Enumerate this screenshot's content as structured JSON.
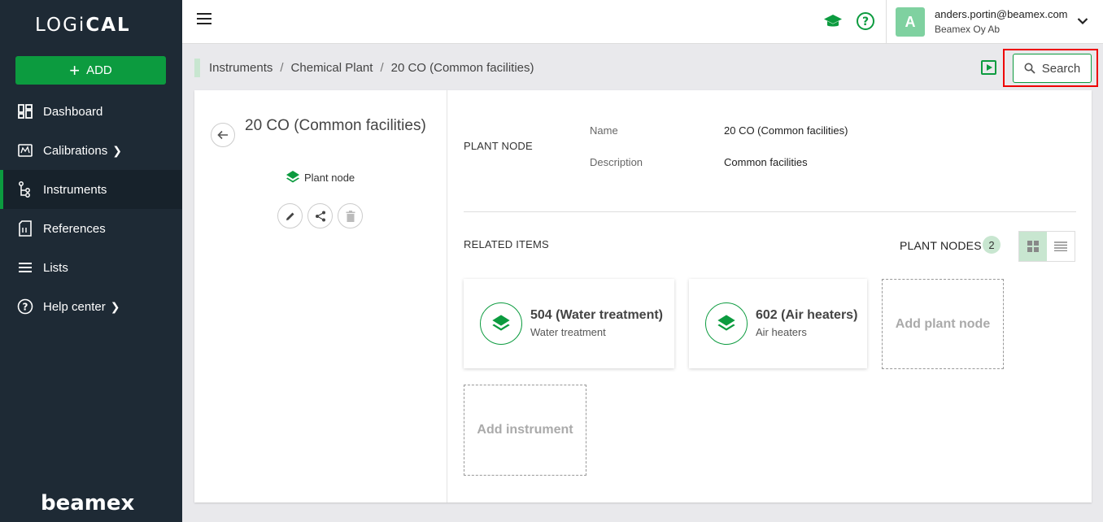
{
  "sidebar": {
    "logo_prefix": "LOGi",
    "logo_suffix": "CAL",
    "add_label": "ADD",
    "items": [
      {
        "label": "Dashboard",
        "icon": "dashboard-icon"
      },
      {
        "label": "Calibrations",
        "icon": "calibrations-icon"
      },
      {
        "label": "Instruments",
        "icon": "instruments-icon"
      },
      {
        "label": "References",
        "icon": "references-icon"
      },
      {
        "label": "Lists",
        "icon": "lists-icon"
      },
      {
        "label": "Help center",
        "icon": "help-icon"
      }
    ],
    "brand": "beamex"
  },
  "header": {
    "user_initial": "A",
    "user_email": "anders.portin@beamex.com",
    "user_org": "Beamex Oy Ab"
  },
  "breadcrumb": {
    "items": [
      "Instruments",
      "Chemical Plant",
      "20 CO (Common facilities)"
    ],
    "search_label": "Search"
  },
  "detail": {
    "title": "20 CO (Common facilities)",
    "type": "Plant node",
    "section_label": "PLANT NODE",
    "name_label": "Name",
    "name_value": "20 CO (Common facilities)",
    "description_label": "Description",
    "description_value": "Common facilities"
  },
  "related": {
    "label": "RELATED ITEMS",
    "plant_nodes_label": "PLANT NODES",
    "plant_nodes_count": "2",
    "cards": [
      {
        "title": "504 (Water treatment)",
        "subtitle": "Water treatment"
      },
      {
        "title": "602 (Air heaters)",
        "subtitle": "Air heaters"
      }
    ],
    "add_plant_node_label": "Add plant node",
    "add_instrument_label": "Add instrument"
  },
  "colors": {
    "accent": "#0c9b3f",
    "sidebar": "#1e2a35",
    "highlight": "#e00000"
  }
}
